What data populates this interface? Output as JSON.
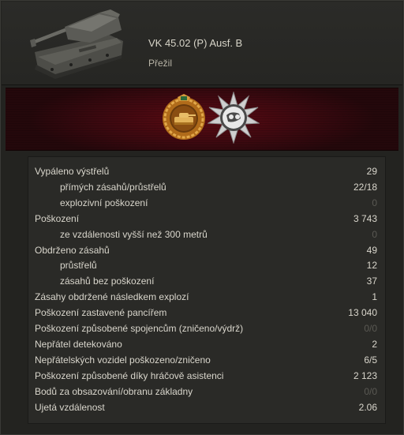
{
  "vehicle": {
    "name": "VK 45.02 (P) Ausf. B",
    "status": "Přežil",
    "icon": "tank-icon"
  },
  "medals": [
    {
      "icon": "tank-badge-medal-icon",
      "color": "#c9862a"
    },
    {
      "icon": "sniper-star-medal-icon",
      "color": "#c8c8c8"
    }
  ],
  "stats": [
    {
      "label": "Vypáleno výstřelů",
      "value": "29",
      "indent": 0,
      "dim": false
    },
    {
      "label": "přímých zásahů/průstřelů",
      "value": "22/18",
      "indent": 1,
      "dim": false
    },
    {
      "label": "explozivní poškození",
      "value": "0",
      "indent": 1,
      "dim": true
    },
    {
      "label": "Poškození",
      "value": "3 743",
      "indent": 0,
      "dim": false
    },
    {
      "label": "ze vzdálenosti vyšší než 300 metrů",
      "value": "0",
      "indent": 1,
      "dim": true
    },
    {
      "label": "Obdrženo zásahů",
      "value": "49",
      "indent": 0,
      "dim": false
    },
    {
      "label": "průstřelů",
      "value": "12",
      "indent": 1,
      "dim": false
    },
    {
      "label": "zásahů bez poškození",
      "value": "37",
      "indent": 1,
      "dim": false
    },
    {
      "label": "Zásahy obdržené následkem explozí",
      "value": "1",
      "indent": 0,
      "dim": false
    },
    {
      "label": "Poškození zastavené pancířem",
      "value": "13 040",
      "indent": 0,
      "dim": false
    },
    {
      "label": "Poškození způsobené spojencům (zničeno/výdrž)",
      "value": "0/0",
      "indent": 0,
      "dim": true
    },
    {
      "label": "Nepřátel detekováno",
      "value": "2",
      "indent": 0,
      "dim": false
    },
    {
      "label": "Nepřátelských vozidel poškozeno/zničeno",
      "value": "6/5",
      "indent": 0,
      "dim": false
    },
    {
      "label": "Poškození způsobené díky hráčově asistenci",
      "value": "2 123",
      "indent": 0,
      "dim": false
    },
    {
      "label": "Bodů za obsazování/obranu základny",
      "value": "0/0",
      "indent": 0,
      "dim": true
    },
    {
      "label": "Ujetá vzdálenost",
      "value": "2.06",
      "indent": 0,
      "dim": false
    }
  ]
}
